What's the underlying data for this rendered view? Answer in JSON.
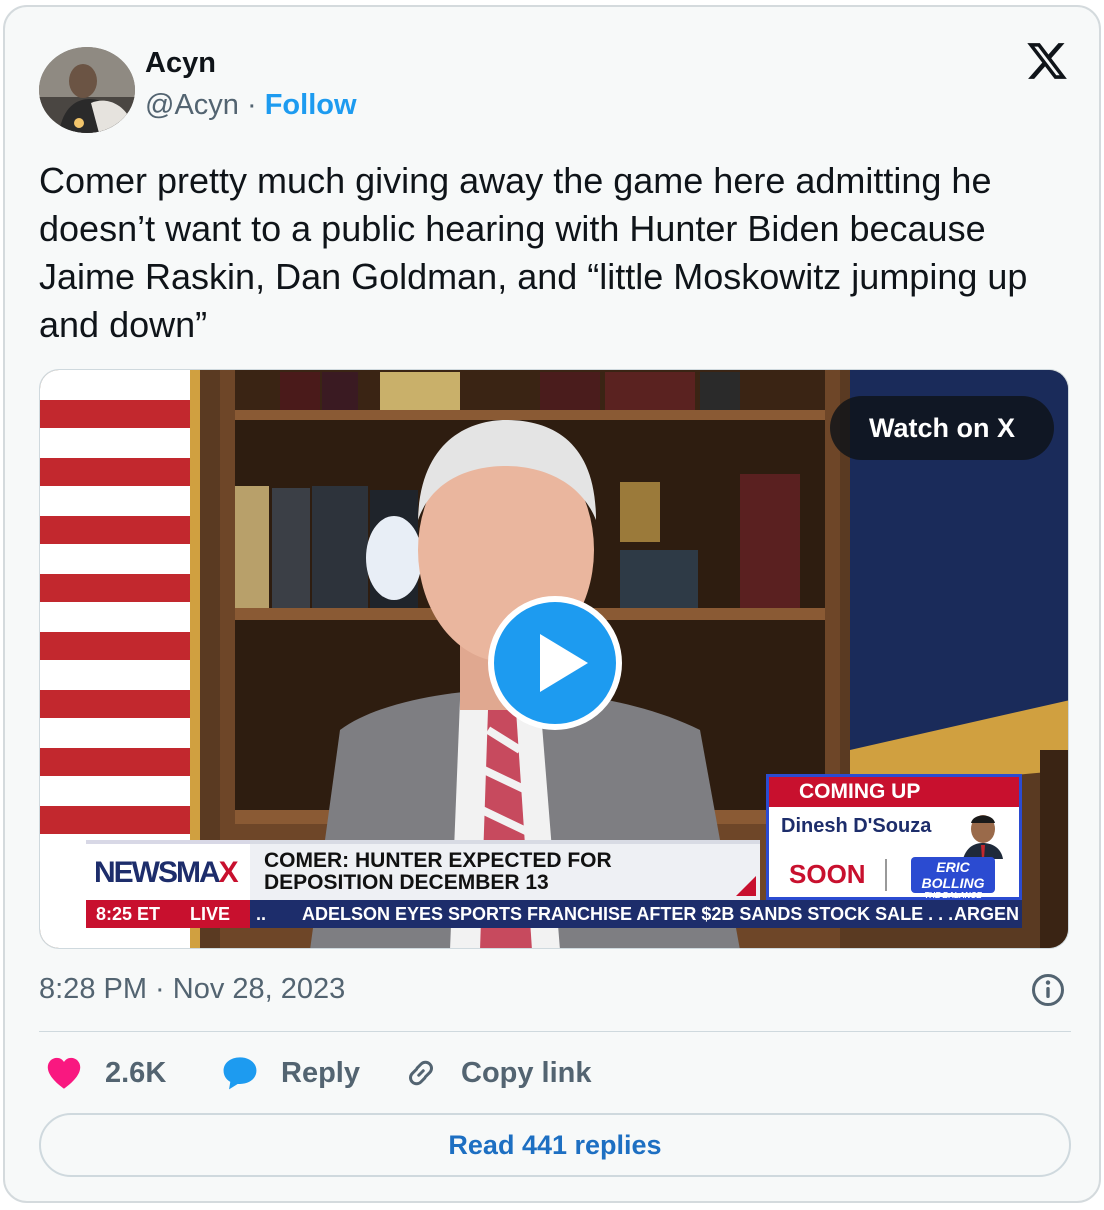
{
  "author": {
    "name": "Acyn",
    "handle": "@Acyn",
    "separator": "·",
    "follow_label": "Follow"
  },
  "tweet": {
    "text": "Comer pretty much giving away the game here admitting he doesn’t want to a public hearing with Hunter Biden because Jaime Raskin, Dan Goldman, and “little Moskowitz jumping up and down”"
  },
  "media": {
    "watch_label": "Watch on X",
    "broadcast": {
      "network_logo_left": "NEWSMA",
      "network_logo_right": "X",
      "headline_line1": "COMER: HUNTER EXPECTED FOR",
      "headline_line2": "DEPOSITION DECEMBER 13",
      "time": "8:25 ET",
      "live": "LIVE",
      "ticker_dots": "..",
      "ticker_text": "ADELSON EYES SPORTS FRANCHISE AFTER $2B SANDS STOCK SALE . . .",
      "ticker_next": "ARGEN",
      "coming_up": "COMING UP",
      "guest_name": "Dinesh D'Souza",
      "soon": "SOON",
      "show_line1": "ERIC",
      "show_line2": "BOLLING",
      "show_line3": "THE BALANCE"
    }
  },
  "meta": {
    "timestamp": "8:28 PM · Nov 28, 2023"
  },
  "actions": {
    "like_count": "2.6K",
    "reply_label": "Reply",
    "copy_label": "Copy link"
  },
  "read_replies_label": "Read 441 replies",
  "colors": {
    "accent": "#1d9bf0",
    "like": "#f91880",
    "link": "#1d6fc2",
    "muted": "#536471"
  }
}
